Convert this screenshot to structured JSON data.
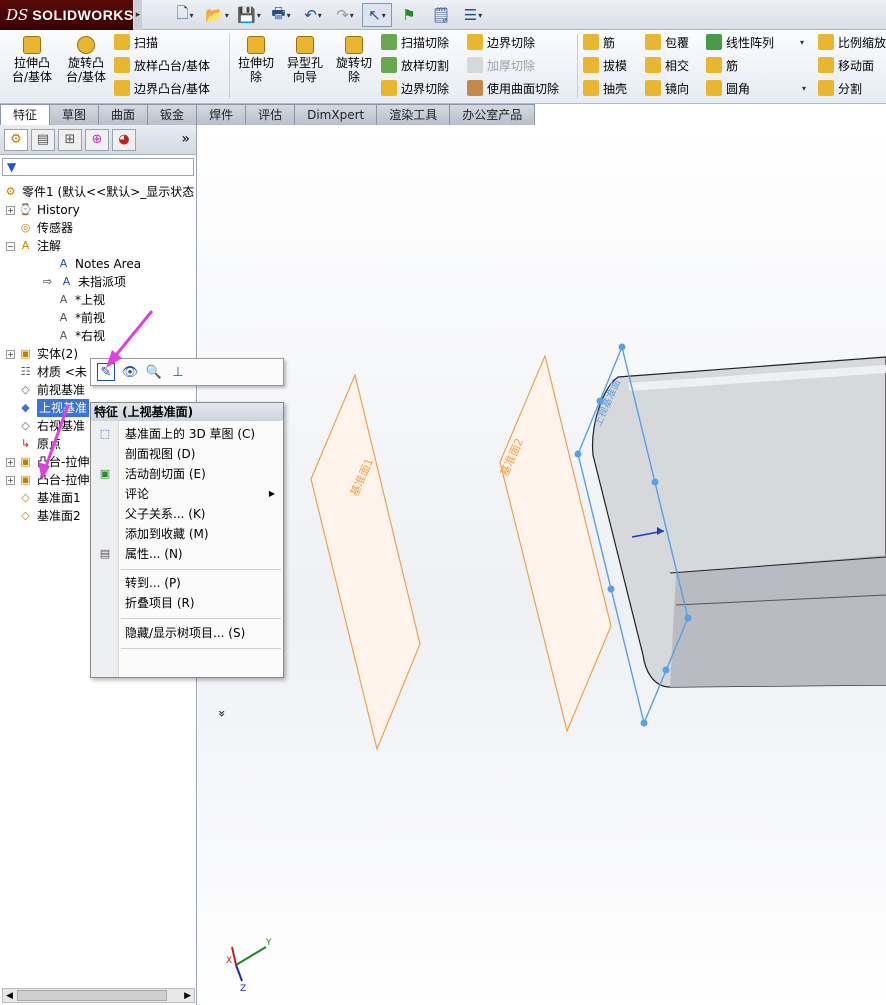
{
  "app": {
    "logo_ds": "DS",
    "logo_name": "SOLIDWORKS"
  },
  "quick_access": [
    {
      "name": "new",
      "icon": "new-document-icon",
      "glyph": "🗋"
    },
    {
      "name": "open",
      "icon": "open-folder-icon",
      "glyph": "📂"
    },
    {
      "name": "save",
      "icon": "save-icon",
      "glyph": "💾"
    },
    {
      "name": "print",
      "icon": "print-icon",
      "glyph": "🖶"
    },
    {
      "name": "undo",
      "icon": "undo-icon",
      "glyph": "↶"
    },
    {
      "name": "redo",
      "icon": "redo-icon",
      "glyph": "↷"
    },
    {
      "name": "select",
      "icon": "select-arrow-icon",
      "glyph": "↖"
    },
    {
      "name": "rebuild",
      "icon": "traffic-light-icon",
      "glyph": "⚑"
    },
    {
      "name": "file-props",
      "icon": "file-properties-icon",
      "glyph": "🗒"
    },
    {
      "name": "options",
      "icon": "options-icon",
      "glyph": "☰"
    }
  ],
  "ribbon": {
    "extrude_boss": "拉伸凸\n台/基体",
    "revolve_boss": "旋转凸\n台/基体",
    "sweep": "扫描",
    "loft": "放样凸台/基体",
    "boundary_boss": "边界凸台/基体",
    "extrude_cut": "拉伸切\n除",
    "hole_wizard": "异型孔\n向导",
    "revolve_cut": "旋转切\n除",
    "swept_cut": "扫描切除",
    "lofted_cut": "放样切割",
    "boundary_cut": "边界切除",
    "boundary_cut2": "边界切除",
    "thicken_cut": "加厚切除",
    "surface_cut": "使用曲面切除",
    "rib": "筋",
    "draft": "拔模",
    "shell": "抽壳",
    "wrap": "包覆",
    "intersect": "相交",
    "mirror": "镜向",
    "linear_pattern": "线性阵列",
    "rib2": "筋",
    "fillet": "圆角",
    "scale": "比例缩放",
    "move_face": "移动面",
    "split": "分割"
  },
  "tabs": [
    "特征",
    "草图",
    "曲面",
    "钣金",
    "焊件",
    "评估",
    "DimXpert",
    "渲染工具",
    "办公室产品"
  ],
  "panel": {
    "filter_icon": "▼",
    "more": "»"
  },
  "tree": {
    "root": "零件1 (默认<<默认>_显示状态",
    "history": "History",
    "sensors": "传感器",
    "annotations": "注解",
    "notes_area": "Notes Area",
    "unassigned": "未指派项",
    "top_view": "*上视",
    "front_view": "*前视",
    "right_view": "*右视",
    "solid_bodies": "实体(2)",
    "material": "材质 <未",
    "front_plane": "前视基准",
    "top_plane": "上视基准",
    "right_plane": "右视基准",
    "origin": "原点",
    "boss1": "凸台-拉伸",
    "boss2": "凸台-拉伸",
    "plane1": "基准面1",
    "plane2": "基准面2"
  },
  "context_menu": {
    "title": "特征 (上视基准面)",
    "items": [
      "基准面上的 3D 草图 (C)",
      "剖面视图 (D)",
      "活动剖切面 (E)",
      "评论",
      "父子关系... (K)",
      "添加到收藏 (M)",
      "属性... (N)",
      "转到... (P)",
      "折叠项目 (R)",
      "隐藏/显示树项目... (S)"
    ],
    "more": "»"
  },
  "canvas": {
    "plane1_label": "基准面1",
    "plane2_label": "基准面2",
    "plane3_label": "上视基准面",
    "axis_y": "Y",
    "axis_x": "X",
    "axis_z": "Z"
  },
  "colors": {
    "accent_selection": "#3a74d8",
    "plane_orange": "#f0a050",
    "pointer_magenta": "#e040e0"
  }
}
